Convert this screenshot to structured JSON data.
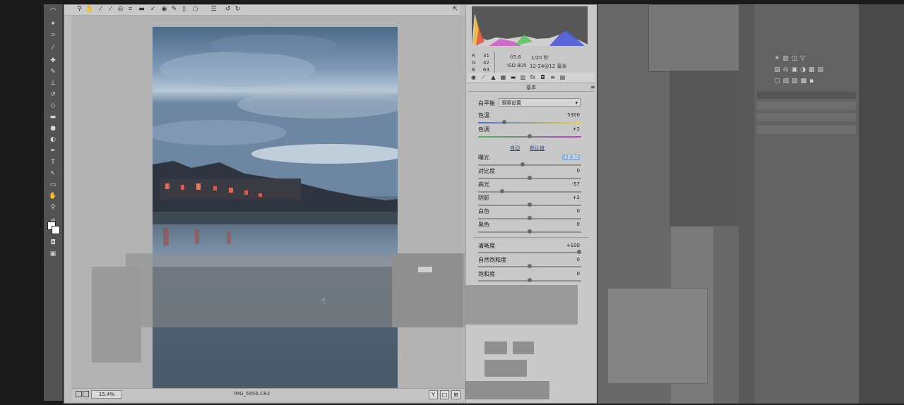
{
  "acr": {
    "filename": "IMG_5956.CR2",
    "zoom": "15.4%",
    "camera_info": {
      "r": "R",
      "r_val": "31",
      "g": "G",
      "g_val": "42",
      "b": "B",
      "b_val": "63",
      "aperture": "f/5.6",
      "shutter": "1/20 秒",
      "iso": "ISO 800",
      "focal": "12-24@12 毫米"
    },
    "panel_title": "基本",
    "white_balance_label": "白平衡",
    "white_balance_value": "原照设置",
    "auto_label": "自动",
    "default_label": "默认值",
    "adjustments": [
      {
        "label": "色温",
        "value": "5300",
        "pos": 0.24
      },
      {
        "label": "色调",
        "value": "+2",
        "pos": 0.5
      },
      {
        "label": "曝光",
        "value": "+0.50",
        "pos": 0.43
      },
      {
        "label": "对比度",
        "value": "0",
        "pos": 0.5
      },
      {
        "label": "高光",
        "value": "-57",
        "pos": 0.22
      },
      {
        "label": "阴影",
        "value": "+2",
        "pos": 0.5
      },
      {
        "label": "白色",
        "value": "0",
        "pos": 0.5
      },
      {
        "label": "黑色",
        "value": "0",
        "pos": 0.5
      },
      {
        "label": "清晰度",
        "value": "+100",
        "pos": 1.0
      },
      {
        "label": "自然饱和度",
        "value": "0",
        "pos": 0.5
      },
      {
        "label": "饱和度",
        "value": "0",
        "pos": 0.5
      }
    ],
    "status_icons": [
      "Y",
      "□",
      "⊞"
    ]
  },
  "colors": {
    "slider_temp_start": "#4a6fd8",
    "slider_temp_end": "#e6d43a",
    "slider_tint_start": "#46c24a",
    "slider_tint_end": "#c23ad0",
    "photo_sky_top": "#5f7592",
    "photo_sky_mid": "#9fb4c9",
    "photo_water": "#3e4a52"
  }
}
